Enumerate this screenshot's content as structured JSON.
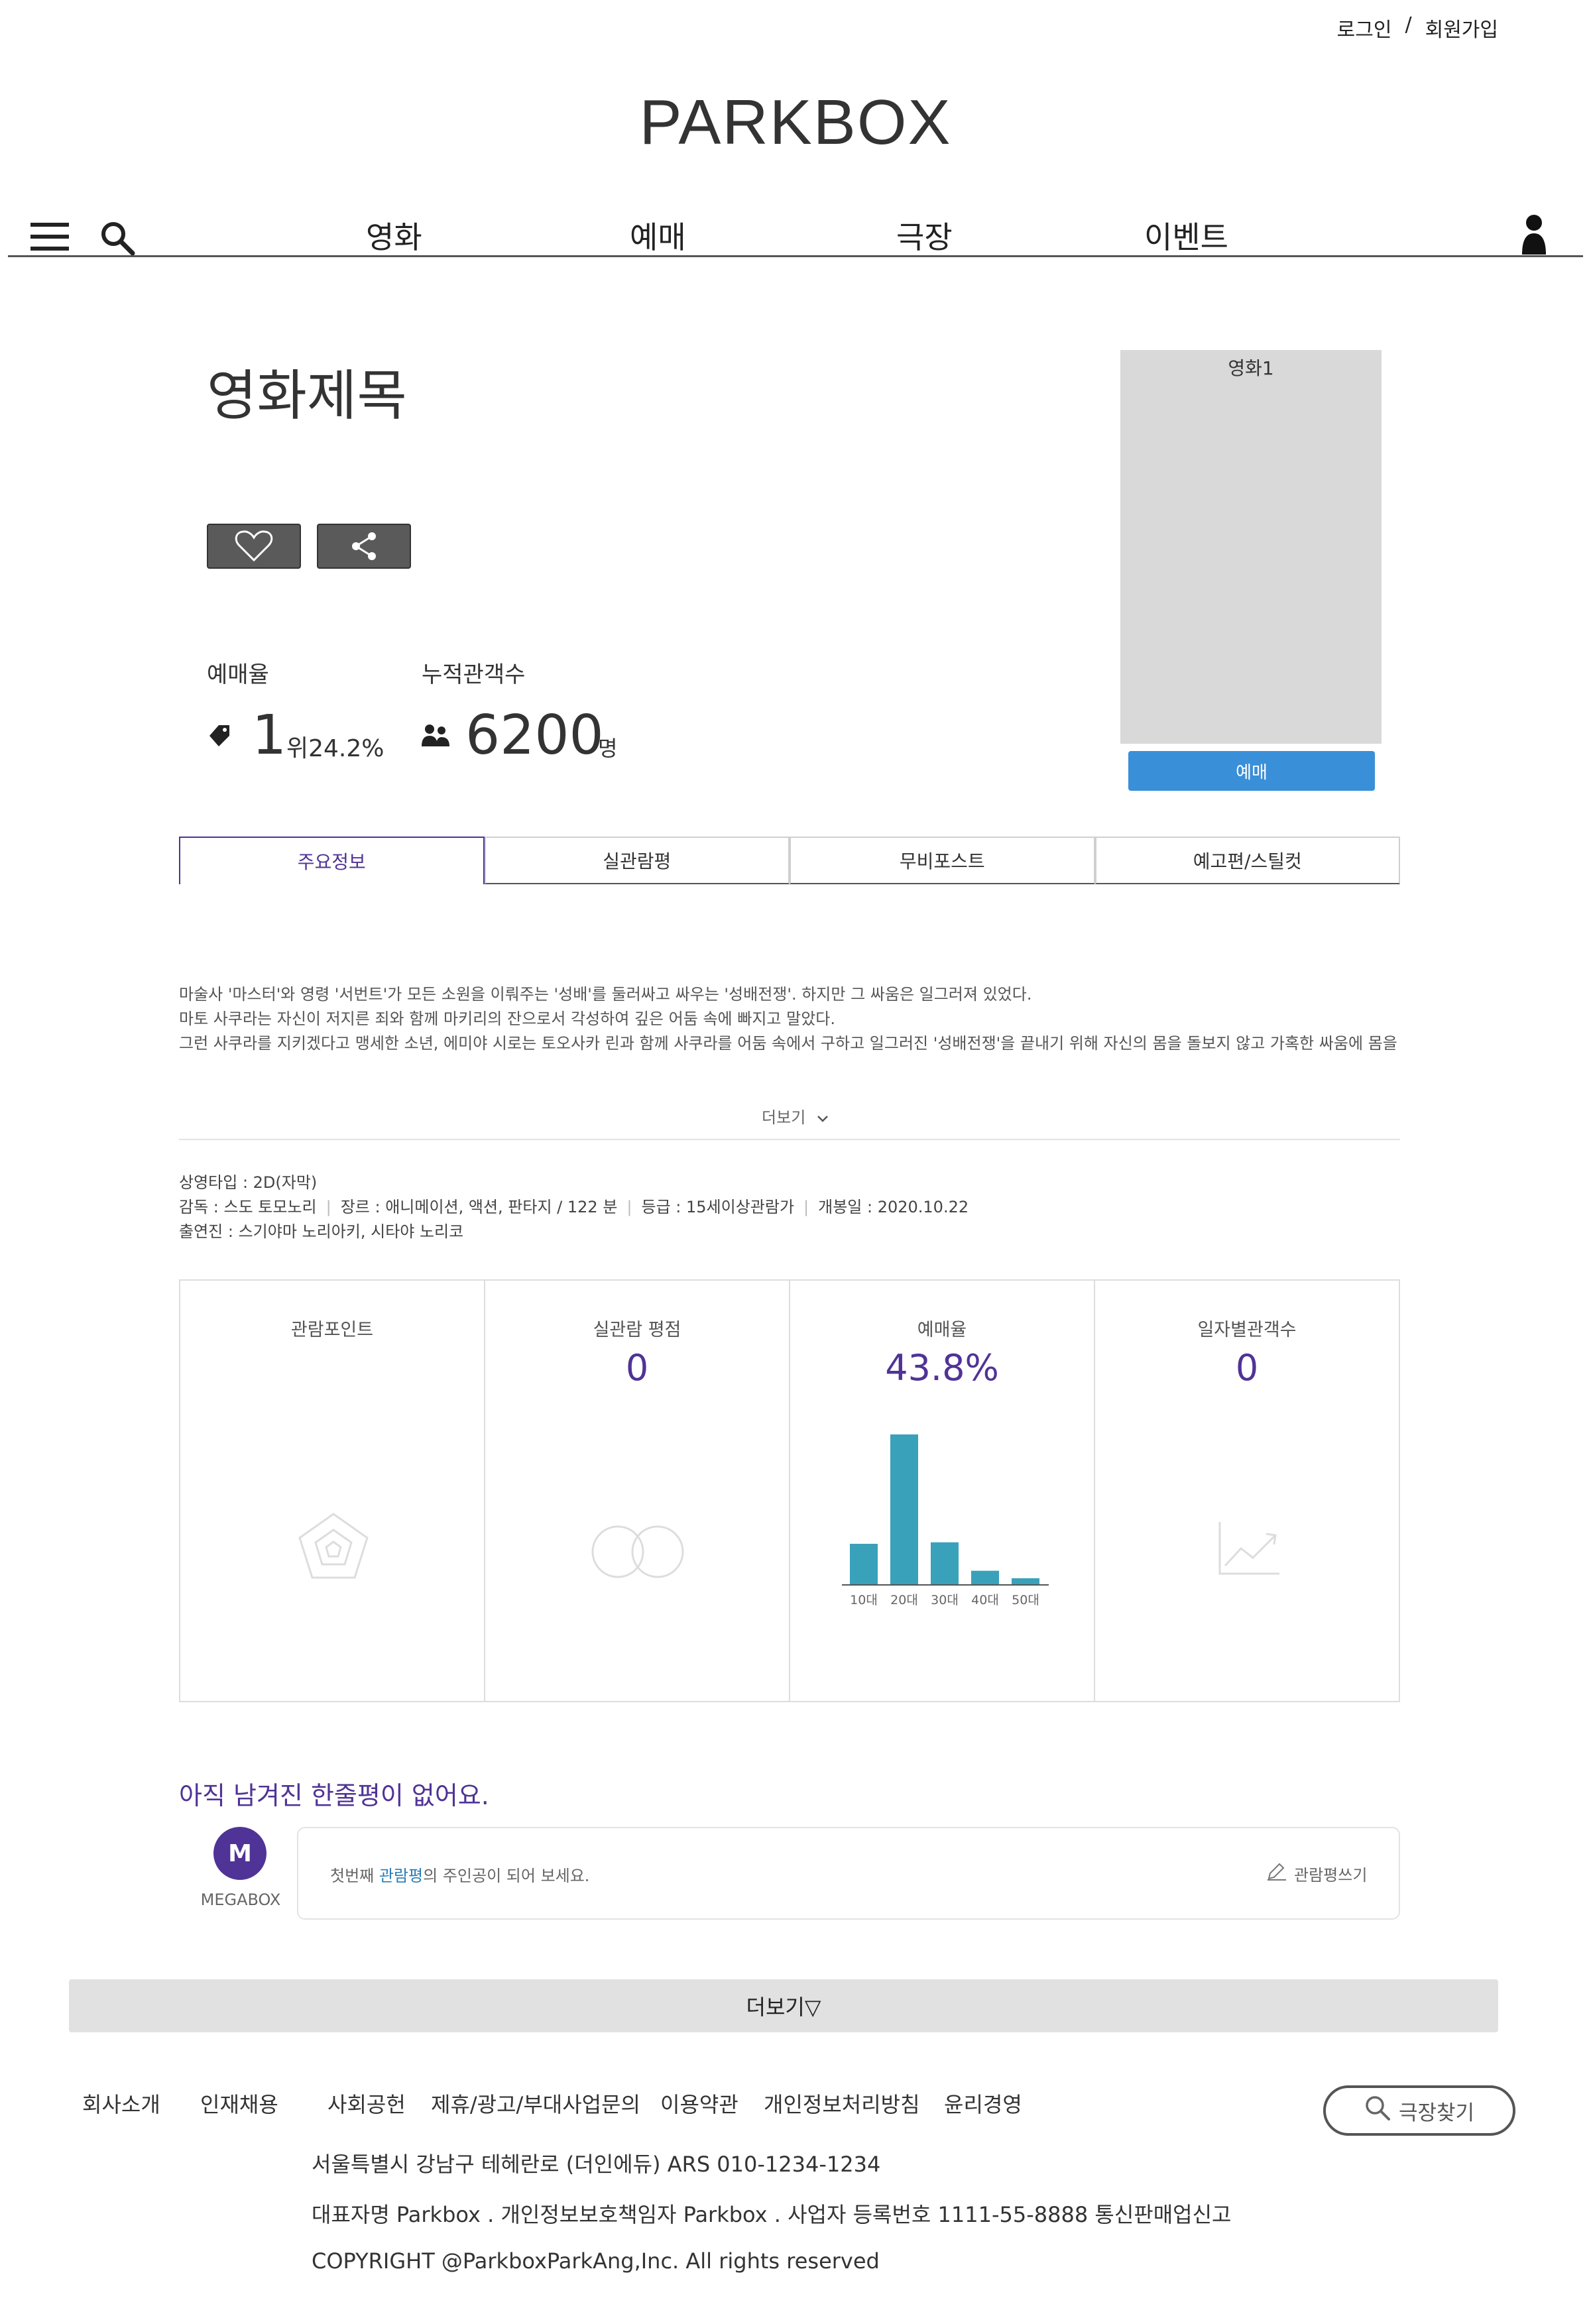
{
  "header": {
    "login": "로그인",
    "separator": "/",
    "signup": "회원가입",
    "logo": "PARKBOX",
    "nav": [
      "영화",
      "예매",
      "극장",
      "이벤트"
    ]
  },
  "movie": {
    "title": "영화제목",
    "booking_rate_label": "예매율",
    "rank": "1",
    "rank_suffix": "위24.2%",
    "audience_label": "누적관객수",
    "audience": "6200",
    "audience_unit": "명",
    "poster_label": "영화1",
    "book_button": "예매"
  },
  "tabs": [
    "주요정보",
    "실관람평",
    "무비포스트",
    "예고편/스틸컷"
  ],
  "synopsis": [
    "마술사 '마스터'와 영령 '서번트'가 모든 소원을 이뤄주는 '성배'를 둘러싸고 싸우는 '성배전쟁'. 하지만 그 싸움은 일그러져 있었다.",
    "마토 사쿠라는 자신이 저지른 죄와 함께 마키리의 잔으로서 각성하여 깊은 어둠 속에 빠지고 말았다.",
    "그런 사쿠라를 지키겠다고 맹세한 소년, 에미야 시로는 토오사카 린과 함께 사쿠라를 어둠 속에서 구하고 일그러진 '성배전쟁'을 끝내기 위해 자신의 몸을 돌보지 않고 가혹한 싸움에 몸을"
  ],
  "more_label": "더보기",
  "info": {
    "screen_type": "상영타입 : 2D(자막)",
    "director": "감독 : 스도 토모노리",
    "genre": "장르 : 애니메이션, 액션, 판타지 / 122 분",
    "rating": "등급 : 15세이상관람가",
    "release": "개봉일 : 2020.10.22",
    "cast": "출연진 : 스기야마 노리아키, 시타야 노리코"
  },
  "stat_boxes": {
    "point_title": "관람포인트",
    "score_title": "실관람 평점",
    "score_value": "0",
    "rate_title": "예매율",
    "rate_value": "43.8%",
    "daily_title": "일자별관객수",
    "daily_value": "0"
  },
  "chart_data": {
    "type": "bar",
    "categories": [
      "10대",
      "20대",
      "30대",
      "40대",
      "50대"
    ],
    "values": [
      27,
      100,
      28,
      9,
      4
    ],
    "title": "",
    "xlabel": "",
    "ylabel": "",
    "ylim": [
      0,
      100
    ],
    "color": "#3aa1ba"
  },
  "review": {
    "heading": "아직 남겨진 한줄평이 없어요.",
    "avatar_letter": "M",
    "avatar_name": "MEGABOX",
    "message_prefix": "첫번째 ",
    "message_highlight": "관람평",
    "message_suffix": "의 주인공이 되어 보세요.",
    "write_label": "관람평쓰기"
  },
  "more_bar": "더보기▽",
  "footer": {
    "links": [
      "회사소개",
      "인재채용",
      "사회공헌",
      "제휴/광고/부대사업문의",
      "이용약관",
      "개인정보처리방침",
      "윤리경영"
    ],
    "theater_search": "극장찾기",
    "address": "서울특별시 강남구 테헤란로 (더인에듀) ARS 010-1234-1234",
    "representative": "대표자명 Parkbox . 개인정보보호책임자 Parkbox . 사업자 등록번호 1111-55-8888 통신판매업신고",
    "copyright": "COPYRIGHT @ParkboxParkAng,Inc. All rights reserved"
  },
  "colors": {
    "accent": "#503396",
    "chart": "#3aa1ba",
    "book_button": "#3a8fd9"
  }
}
